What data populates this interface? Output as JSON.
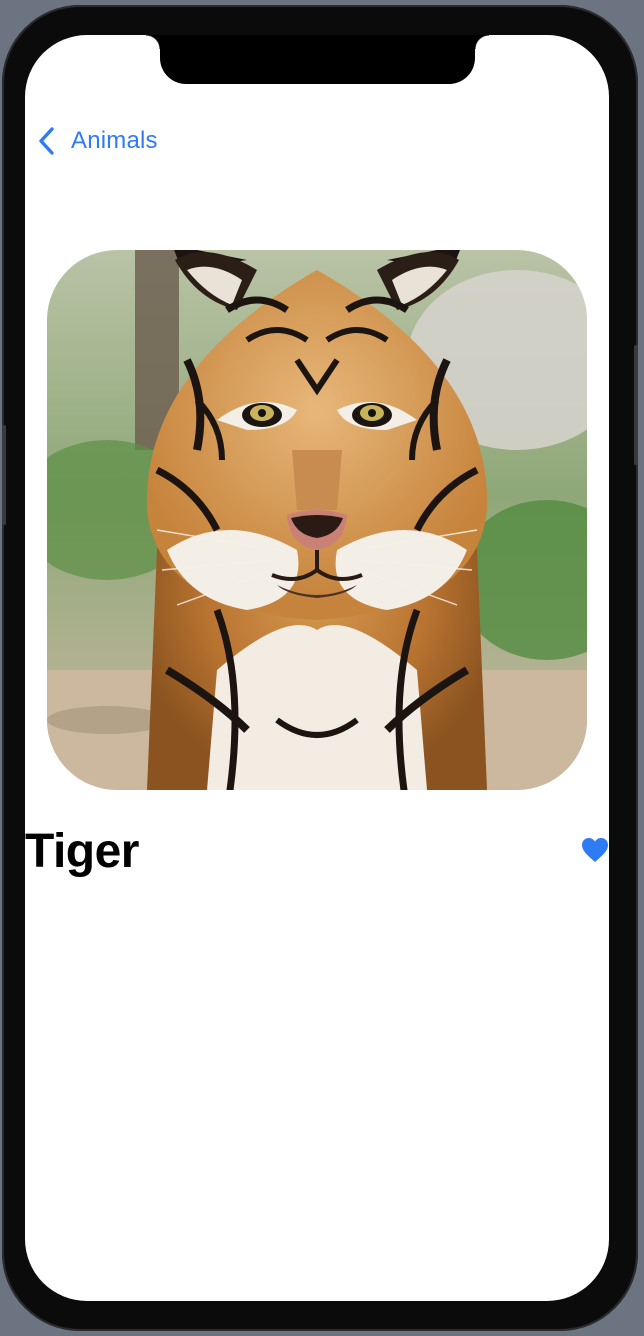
{
  "nav": {
    "back_label": "Animals"
  },
  "detail": {
    "title": "Tiger",
    "favorite": true,
    "image_subject": "tiger"
  },
  "colors": {
    "accent": "#2f7bf5",
    "background": "#ffffff"
  },
  "icons": {
    "back": "chevron-left-icon",
    "favorite": "heart-icon"
  }
}
